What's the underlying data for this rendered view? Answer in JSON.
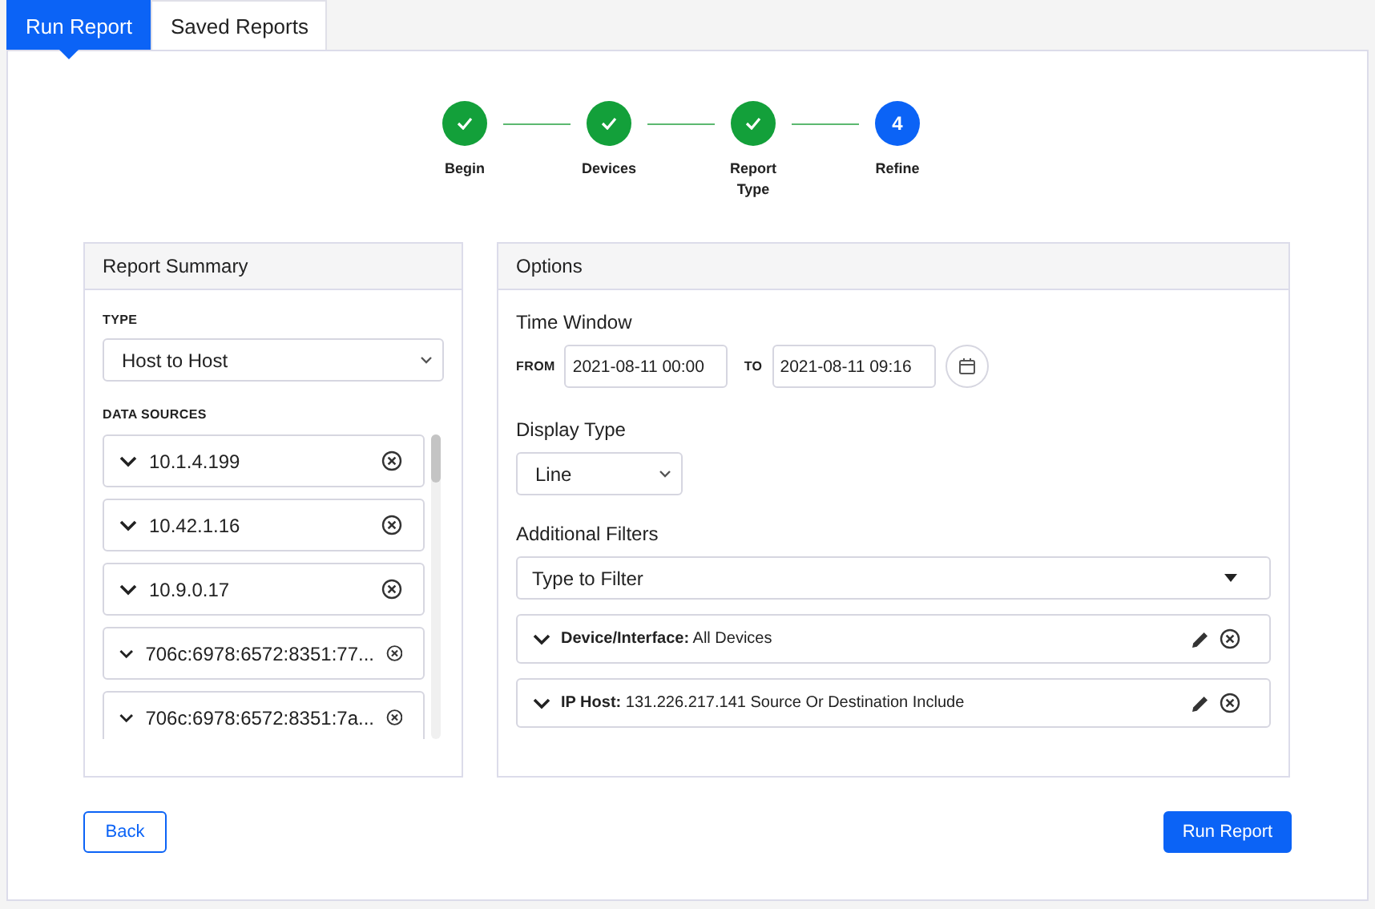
{
  "tabs": [
    {
      "label": "Run Report",
      "selected": true
    },
    {
      "label": "Saved Reports",
      "selected": false
    }
  ],
  "steps": [
    {
      "label": "Begin",
      "completed": true
    },
    {
      "label": "Devices",
      "completed": true
    },
    {
      "label": "Report Type",
      "completed": true
    },
    {
      "label": "Refine",
      "completed": false,
      "number": "4"
    }
  ],
  "summary": {
    "title": "Report Summary",
    "type_label": "TYPE",
    "type_value": "Host to Host",
    "sources_label": "DATA SOURCES",
    "sources": [
      "10.1.4.199",
      "10.42.1.16",
      "10.9.0.17",
      "706c:6978:6572:8351:77...",
      "706c:6978:6572:8351:7a..."
    ]
  },
  "options": {
    "title": "Options",
    "time_window_label": "Time Window",
    "from_label": "FROM",
    "from_value": "2021-08-11 00:00",
    "to_label": "TO",
    "to_value": "2021-08-11 09:16",
    "display_type_label": "Display Type",
    "display_type_value": "Line",
    "filters_label": "Additional Filters",
    "filter_placeholder": "Type to Filter",
    "filters": [
      "**Device/Interface:** All Devices",
      "**IP Host:** 131.226.217.141 Source Or Destination Include"
    ]
  },
  "buttons": {
    "back": "Back",
    "run": "Run Report"
  }
}
